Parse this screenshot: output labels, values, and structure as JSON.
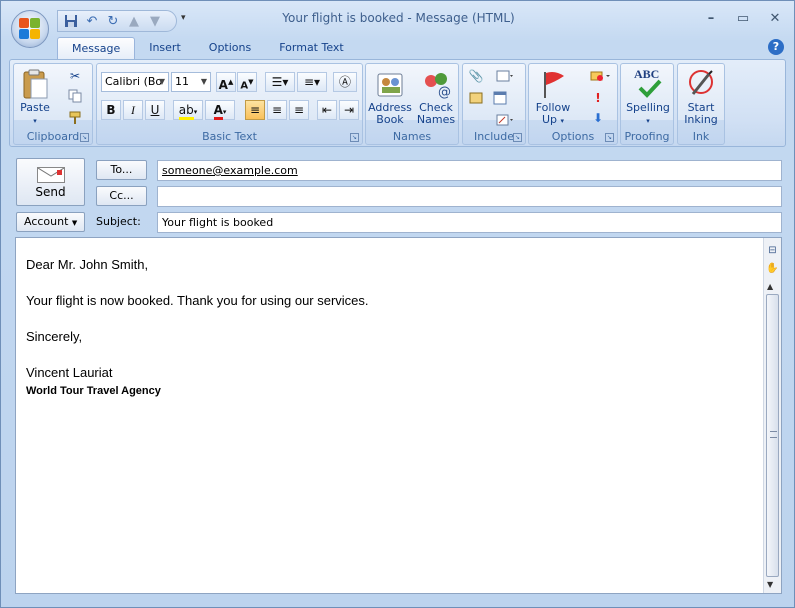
{
  "window": {
    "title": "Your flight is booked - Message (HTML)",
    "minimize": "–",
    "maximize": "▭",
    "close": "✕"
  },
  "ribbon": {
    "tabs": [
      "Message",
      "Insert",
      "Options",
      "Format Text"
    ],
    "help": "?",
    "groups": {
      "clipboard": {
        "label": "Clipboard",
        "paste": "Paste"
      },
      "basic_text": {
        "label": "Basic Text",
        "font": "Calibri (Bo",
        "size": "11",
        "bold": "B",
        "italic": "I",
        "underline": "U",
        "grow": "A",
        "shrink": "A",
        "color": "A"
      },
      "names": {
        "label": "Names",
        "address_book": [
          "Address",
          "Book"
        ],
        "check_names": [
          "Check",
          "Names"
        ]
      },
      "include": {
        "label": "Include"
      },
      "options": {
        "label": "Options",
        "follow_up": [
          "Follow",
          "Up"
        ]
      },
      "proofing": {
        "label": "Proofing",
        "spelling": "Spelling",
        "abc": "ABC"
      },
      "ink": {
        "label": "Ink",
        "start_inking": [
          "Start",
          "Inking"
        ]
      }
    }
  },
  "header": {
    "send": "Send",
    "to_button": "To...",
    "cc_button": "Cc...",
    "account_button": "Account",
    "subject_label": "Subject:",
    "to_value": "someone@example.com",
    "cc_value": "",
    "subject_value": "Your flight is booked"
  },
  "body": {
    "greeting": "Dear Mr. John Smith,",
    "line1": "Your flight is now booked. Thank you for using our services.",
    "closing": "Sincerely,",
    "sender_name": "Vincent Lauriat",
    "sender_company": "World Tour Travel Agency"
  },
  "colors": {
    "accent": "#15428b",
    "ribbon": "#d1e0f4",
    "highlight": "#f9c05a"
  }
}
